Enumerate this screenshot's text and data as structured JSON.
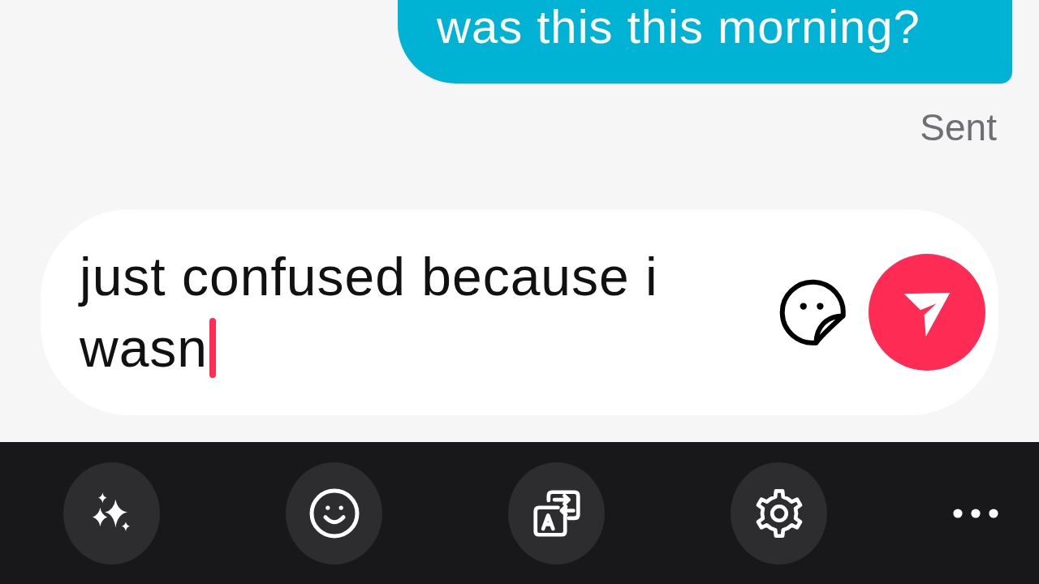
{
  "messages": [
    {
      "kind": "outgoing",
      "text": "was this this morning?"
    }
  ],
  "delivery_status": "Sent",
  "composer": {
    "value": "just confused because i wasn",
    "focused": true
  }
}
